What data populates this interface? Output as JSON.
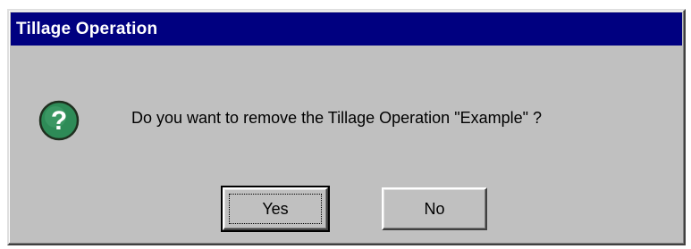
{
  "window": {
    "title": "Tillage Operation"
  },
  "message": {
    "text": "Do you want to remove the Tillage Operation \"Example\" ?",
    "icon": "question-icon"
  },
  "buttons": {
    "yes_label": "Yes",
    "no_label": "No",
    "default": "Yes"
  },
  "colors": {
    "titlebar": "#000080",
    "dialog_face": "#c0c0c0",
    "icon_fill": "#2e8b57"
  }
}
